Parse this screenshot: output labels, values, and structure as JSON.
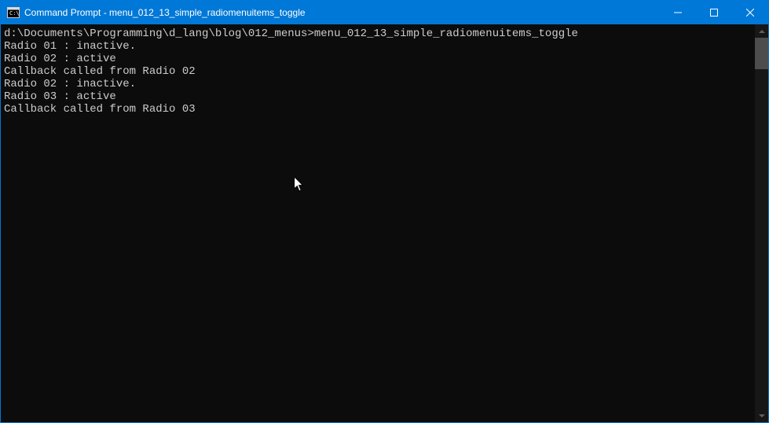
{
  "window": {
    "title": "Command Prompt - menu_012_13_simple_radiomenuitems_toggle"
  },
  "terminal": {
    "prompt_path": "d:\\Documents\\Programming\\d_lang\\blog\\012_menus>",
    "prompt_cmd": "menu_012_13_simple_radiomenuitems_toggle",
    "lines": [
      "Radio 01 : inactive.",
      "Radio 02 : active",
      "Callback called from Radio 02",
      "Radio 02 : inactive.",
      "Radio 03 : active",
      "Callback called from Radio 03"
    ]
  }
}
